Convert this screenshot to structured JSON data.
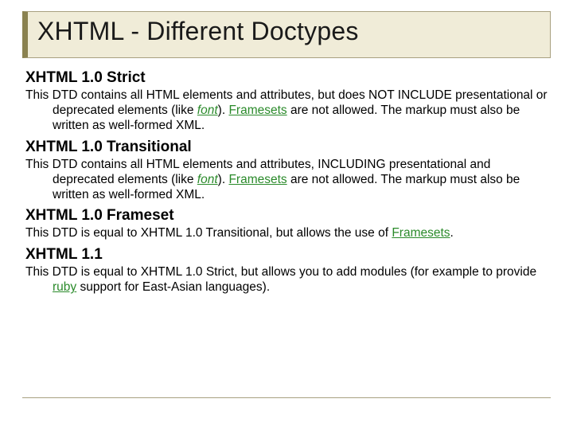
{
  "title": "XHTML - Different Doctypes",
  "sections": [
    {
      "heading": "XHTML 1.0 Strict",
      "body_pre": "This DTD contains all HTML elements and attributes, but does NOT INCLUDE presentational or deprecated elements (like ",
      "link1": "font",
      "body_mid": "). ",
      "link2": "Framesets",
      "body_post": " are not allowed. The markup must also be written as well-formed XML."
    },
    {
      "heading": "XHTML 1.0 Transitional",
      "body_pre": "This DTD contains all HTML elements and attributes, INCLUDING presentational and deprecated elements (like ",
      "link1": "font",
      "body_mid": "). ",
      "link2": "Framesets",
      "body_post": " are not allowed. The markup must also be written as well-formed XML."
    },
    {
      "heading": "XHTML 1.0 Frameset",
      "body_pre": "This DTD is equal to XHTML 1.0 Transitional, but allows the use of ",
      "link1": "Framesets",
      "body_mid": ".",
      "link2": "",
      "body_post": ""
    },
    {
      "heading": "XHTML 1.1",
      "body_pre": "This DTD is equal to XHTML 1.0 Strict, but allows you to add modules (for example to provide ",
      "link1": "ruby",
      "body_mid": " support for East-Asian languages).",
      "link2": "",
      "body_post": ""
    }
  ]
}
